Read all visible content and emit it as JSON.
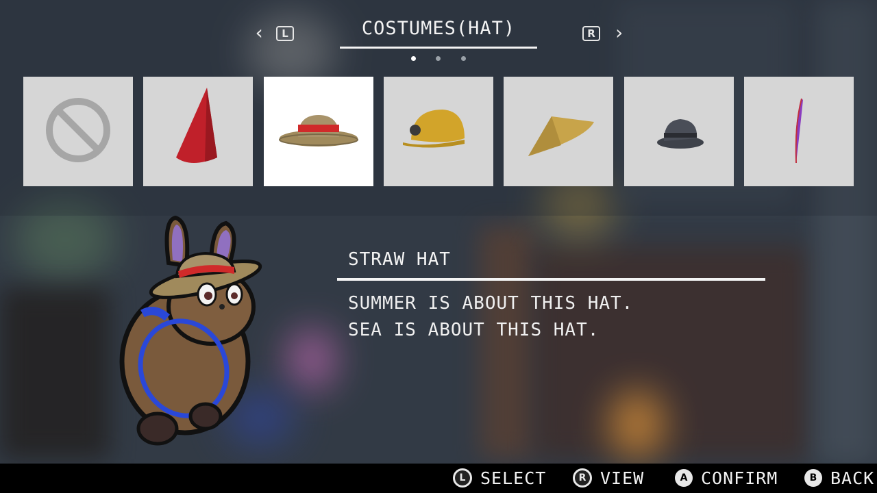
{
  "header": {
    "title": "COSTUMES(HAT)",
    "left_button": "L",
    "right_button": "R",
    "left_arrow_icon": "chevron-left-icon",
    "right_arrow_icon": "chevron-right-icon",
    "page_count": 3,
    "active_page": 1
  },
  "items": [
    {
      "icon": "none-icon",
      "selected": false
    },
    {
      "icon": "cone-hat-icon",
      "selected": false
    },
    {
      "icon": "straw-hat-icon",
      "selected": true
    },
    {
      "icon": "mining-helmet-icon",
      "selected": false
    },
    {
      "icon": "conical-straw-hat-icon",
      "selected": false
    },
    {
      "icon": "fedora-icon",
      "selected": false
    },
    {
      "icon": "feather-icon",
      "selected": false
    }
  ],
  "selected_item": {
    "name": "STRAW HAT",
    "description_line1": "SUMMER IS ABOUT THIS HAT.",
    "description_line2": "SEA IS ABOUT THIS HAT."
  },
  "controls": {
    "select": {
      "button": "L",
      "label": "SELECT"
    },
    "view": {
      "button": "R",
      "label": "VIEW"
    },
    "confirm": {
      "button": "A",
      "label": "CONFIRM"
    },
    "back": {
      "button": "B",
      "label": "BACK"
    }
  },
  "colors": {
    "selected_tile": "#ffffff",
    "tile": "#d6d6d6",
    "bottom_bar": "#000000"
  }
}
